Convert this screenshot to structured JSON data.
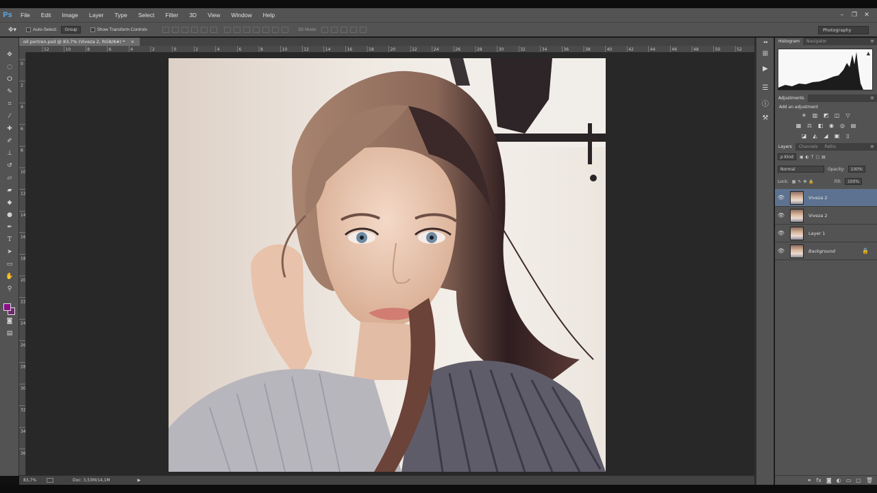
{
  "app": {
    "logo": "Ps"
  },
  "menu": [
    "File",
    "Edit",
    "Image",
    "Layer",
    "Type",
    "Select",
    "Filter",
    "3D",
    "View",
    "Window",
    "Help"
  ],
  "window_controls": [
    "–",
    "❐",
    "✕"
  ],
  "options_bar": {
    "auto_select_label": "Auto-Select:",
    "auto_select_value": "Group",
    "show_transform_label": "Show Transform Controls",
    "mode_3d_label": "3D Mode:",
    "workspace": "Photography"
  },
  "document": {
    "tab_title": "oil portren.psd @ 83,7% (Viveza 2, RGB/8#) *",
    "tab_close": "×"
  },
  "ruler": {
    "h_ticks": [
      "12",
      "10",
      "8",
      "6",
      "4",
      "2",
      "0",
      "2",
      "4",
      "6",
      "8",
      "10",
      "12",
      "14",
      "16",
      "18",
      "20",
      "22",
      "24",
      "26",
      "28",
      "30",
      "32",
      "34",
      "36",
      "38",
      "40",
      "42",
      "44",
      "46",
      "48",
      "50",
      "52"
    ],
    "v_ticks": [
      "0",
      "2",
      "4",
      "6",
      "8",
      "10",
      "12",
      "14",
      "16",
      "18",
      "20",
      "22",
      "24",
      "26",
      "28",
      "30",
      "32",
      "34",
      "36"
    ]
  },
  "status": {
    "zoom": "83,7%",
    "doc_info": "Doc: 3,53M/14,1M",
    "arrow": "▶"
  },
  "panels": {
    "histogram_tabs": [
      "Histogram",
      "Navigator"
    ],
    "adjustments_tab": "Adjustments",
    "add_adjustment": "Add an adjustment",
    "layers_tabs": [
      "Layers",
      "Channels",
      "Paths"
    ],
    "kind_filter": "ρ Kind",
    "blend_mode": "Normal",
    "opacity_label": "Opacity:",
    "opacity_value": "100%",
    "lock_label": "Lock:",
    "fill_label": "Fill:",
    "fill_value": "100%",
    "layers": [
      {
        "name": "Viveza 2",
        "selected": true,
        "locked": false
      },
      {
        "name": "Viveza 2",
        "selected": false,
        "locked": false
      },
      {
        "name": "Layer 1",
        "selected": false,
        "locked": false
      },
      {
        "name": "Background",
        "selected": false,
        "locked": true
      }
    ]
  },
  "colors": {
    "foreground": "#8a0f8a",
    "background": "#6d2a6d",
    "selected_layer": "#5d7290"
  }
}
